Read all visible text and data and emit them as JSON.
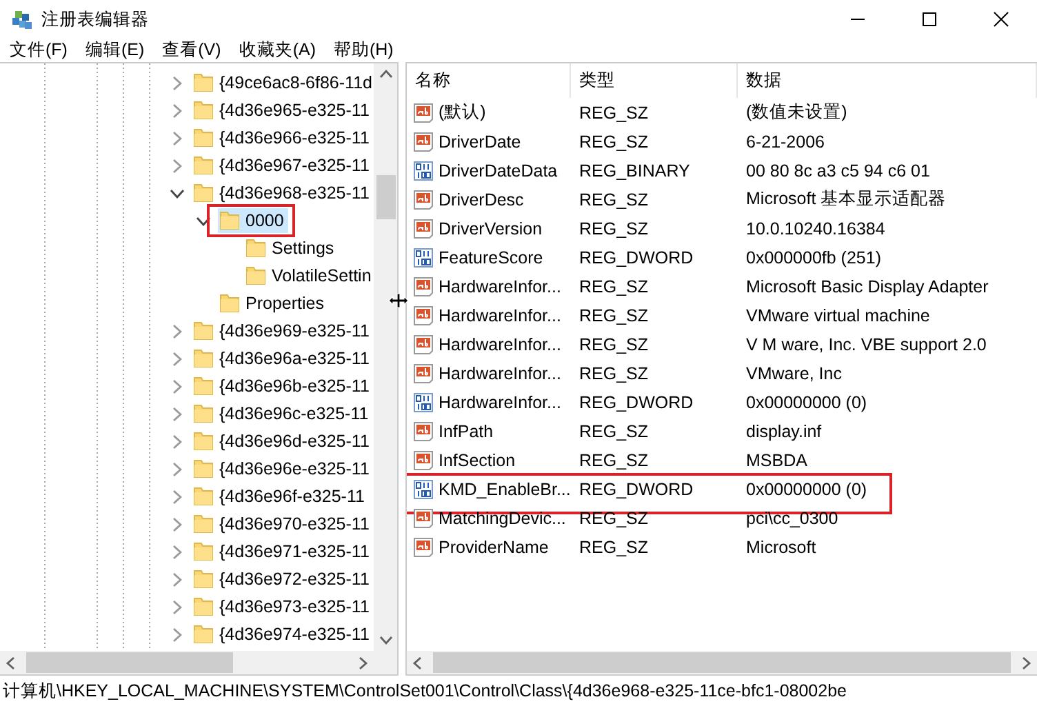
{
  "window": {
    "title": "注册表编辑器"
  },
  "menu": [
    "文件(F)",
    "编辑(E)",
    "查看(V)",
    "收藏夹(A)",
    "帮助(H)"
  ],
  "tree": [
    {
      "label": "{49ce6ac8-6f86-11d",
      "expanded": false,
      "selected": false,
      "marked": false
    },
    {
      "label": "{4d36e965-e325-11",
      "expanded": false,
      "selected": false,
      "marked": false
    },
    {
      "label": "{4d36e966-e325-11",
      "expanded": false,
      "selected": false,
      "marked": false
    },
    {
      "label": "{4d36e967-e325-11",
      "expanded": false,
      "selected": false,
      "marked": false
    },
    {
      "label": "{4d36e968-e325-11",
      "expanded": true,
      "selected": false,
      "marked": false,
      "children": [
        {
          "label": "0000",
          "expanded": true,
          "selected": true,
          "marked": true,
          "children": [
            {
              "label": "Settings",
              "selected": false,
              "marked": false
            },
            {
              "label": "VolatileSettin",
              "selected": false,
              "marked": false
            }
          ]
        },
        {
          "label": "Properties",
          "selected": false,
          "marked": false
        }
      ]
    },
    {
      "label": "{4d36e969-e325-11",
      "expanded": false,
      "selected": false,
      "marked": false
    },
    {
      "label": "{4d36e96a-e325-11",
      "expanded": false,
      "selected": false,
      "marked": false
    },
    {
      "label": "{4d36e96b-e325-11",
      "expanded": false,
      "selected": false,
      "marked": false
    },
    {
      "label": "{4d36e96c-e325-11",
      "expanded": false,
      "selected": false,
      "marked": false
    },
    {
      "label": "{4d36e96d-e325-11",
      "expanded": false,
      "selected": false,
      "marked": false
    },
    {
      "label": "{4d36e96e-e325-11",
      "expanded": false,
      "selected": false,
      "marked": false
    },
    {
      "label": "{4d36e96f-e325-11",
      "expanded": false,
      "selected": false,
      "marked": false
    },
    {
      "label": "{4d36e970-e325-11",
      "expanded": false,
      "selected": false,
      "marked": false
    },
    {
      "label": "{4d36e971-e325-11",
      "expanded": false,
      "selected": false,
      "marked": false
    },
    {
      "label": "{4d36e972-e325-11",
      "expanded": false,
      "selected": false,
      "marked": false
    },
    {
      "label": "{4d36e973-e325-11",
      "expanded": false,
      "selected": false,
      "marked": false
    },
    {
      "label": "{4d36e974-e325-11",
      "expanded": false,
      "selected": false,
      "marked": false
    }
  ],
  "values": {
    "columns": [
      "名称",
      "类型",
      "数据"
    ],
    "rows": [
      {
        "kind": "string",
        "name": "(默认)",
        "type": "REG_SZ",
        "data": "(数值未设置)",
        "marked": false
      },
      {
        "kind": "string",
        "name": "DriverDate",
        "type": "REG_SZ",
        "data": "6-21-2006",
        "marked": false
      },
      {
        "kind": "binary",
        "name": "DriverDateData",
        "type": "REG_BINARY",
        "data": "00 80 8c a3 c5 94 c6 01",
        "marked": false
      },
      {
        "kind": "string",
        "name": "DriverDesc",
        "type": "REG_SZ",
        "data": "Microsoft 基本显示适配器",
        "marked": false
      },
      {
        "kind": "string",
        "name": "DriverVersion",
        "type": "REG_SZ",
        "data": "10.0.10240.16384",
        "marked": false
      },
      {
        "kind": "binary",
        "name": "FeatureScore",
        "type": "REG_DWORD",
        "data": "0x000000fb (251)",
        "marked": false
      },
      {
        "kind": "string",
        "name": "HardwareInfor...",
        "type": "REG_SZ",
        "data": "Microsoft Basic Display Adapter",
        "marked": false
      },
      {
        "kind": "string",
        "name": "HardwareInfor...",
        "type": "REG_SZ",
        "data": "VMware virtual machine",
        "marked": false
      },
      {
        "kind": "string",
        "name": "HardwareInfor...",
        "type": "REG_SZ",
        "data": "V M ware, Inc. VBE support 2.0",
        "marked": false
      },
      {
        "kind": "string",
        "name": "HardwareInfor...",
        "type": "REG_SZ",
        "data": "VMware, Inc",
        "marked": false
      },
      {
        "kind": "binary",
        "name": "HardwareInfor...",
        "type": "REG_DWORD",
        "data": "0x00000000 (0)",
        "marked": false
      },
      {
        "kind": "string",
        "name": "InfPath",
        "type": "REG_SZ",
        "data": "display.inf",
        "marked": false
      },
      {
        "kind": "string",
        "name": "InfSection",
        "type": "REG_SZ",
        "data": "MSBDA",
        "marked": false
      },
      {
        "kind": "binary",
        "name": "KMD_EnableBr...",
        "type": "REG_DWORD",
        "data": "0x00000000 (0)",
        "marked": true
      },
      {
        "kind": "string",
        "name": "MatchingDevic...",
        "type": "REG_SZ",
        "data": "pci\\cc_0300",
        "marked": false
      },
      {
        "kind": "string",
        "name": "ProviderName",
        "type": "REG_SZ",
        "data": "Microsoft",
        "marked": false
      }
    ]
  },
  "status_bar": "计算机\\HKEY_LOCAL_MACHINE\\SYSTEM\\ControlSet001\\Control\\Class\\{4d36e968-e325-11ce-bfc1-08002be"
}
